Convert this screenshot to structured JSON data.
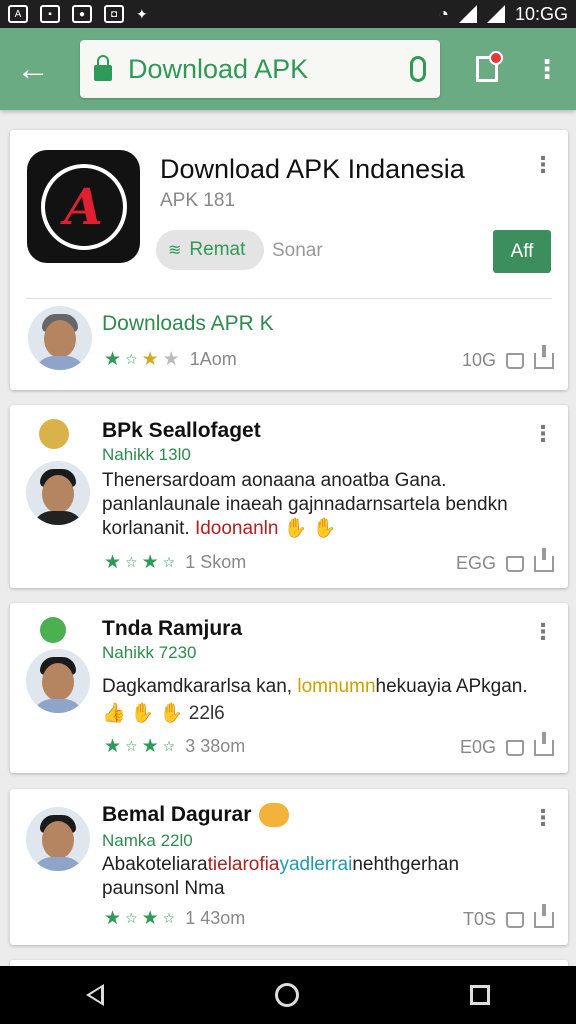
{
  "status_bar": {
    "time": "10:GG",
    "left_icons": [
      "notification-icon",
      "gallery-icon",
      "bag-icon",
      "app-icon",
      "flag-icon"
    ],
    "right_icons": [
      "wifi-icon",
      "signal-icon",
      "signal-icon"
    ]
  },
  "search": {
    "value": "Download APK",
    "icons": [
      "back-arrow-icon",
      "lock-icon",
      "mic-icon",
      "library-icon",
      "more-icon"
    ]
  },
  "app": {
    "title": "Download APK Indanesia",
    "subtitle": "APK 181",
    "chip_label": "Remat",
    "chip_secondary": "Sonar",
    "install_label": "Aff",
    "developer": "Downloads APR K",
    "rating_count": "1Aom",
    "meta": "10G"
  },
  "reviews": [
    {
      "name": "BPk Seallofaget",
      "sub": "Nahikk 13l0",
      "body_line1": "Thenersardoam aonaana anoatba Gana.",
      "body_line2": "panlanlaunale inaeah gajnnadarnsartela bendkn",
      "body_line3_prefix": "korlananit. ",
      "body_line3_highlight": "Idoonanln",
      "body_line3_suffix": " ✋ ✋",
      "rating_count": "1 Skom",
      "meta": "EGG"
    },
    {
      "name": "Tnda Ramjura",
      "sub": "Nahikk 7230",
      "body_line1_prefix": "Dagkamdkararlsa kan, ",
      "body_line1_highlight": "lomnumn",
      "body_line1_suffix": "hekuayia APkgan.",
      "extra": "👍 ✋ ✋ 22l6",
      "rating_count": "3 38om",
      "meta": "E0G"
    },
    {
      "name": "Bemal Dagurar",
      "sub": "Namka 22l0",
      "body_line1_prefix": "Abakoteliara",
      "body_line1_red": "tielarofia",
      "body_line1_blue": "yadlerrai",
      "body_line1_suffix": "nehthgerhan",
      "body_line2": "paunsonl Nma",
      "rating_count": "1 43om",
      "meta": "T0S"
    }
  ],
  "nav": {
    "icons": [
      "nav-back-icon",
      "nav-home-icon",
      "nav-recents-icon"
    ]
  }
}
